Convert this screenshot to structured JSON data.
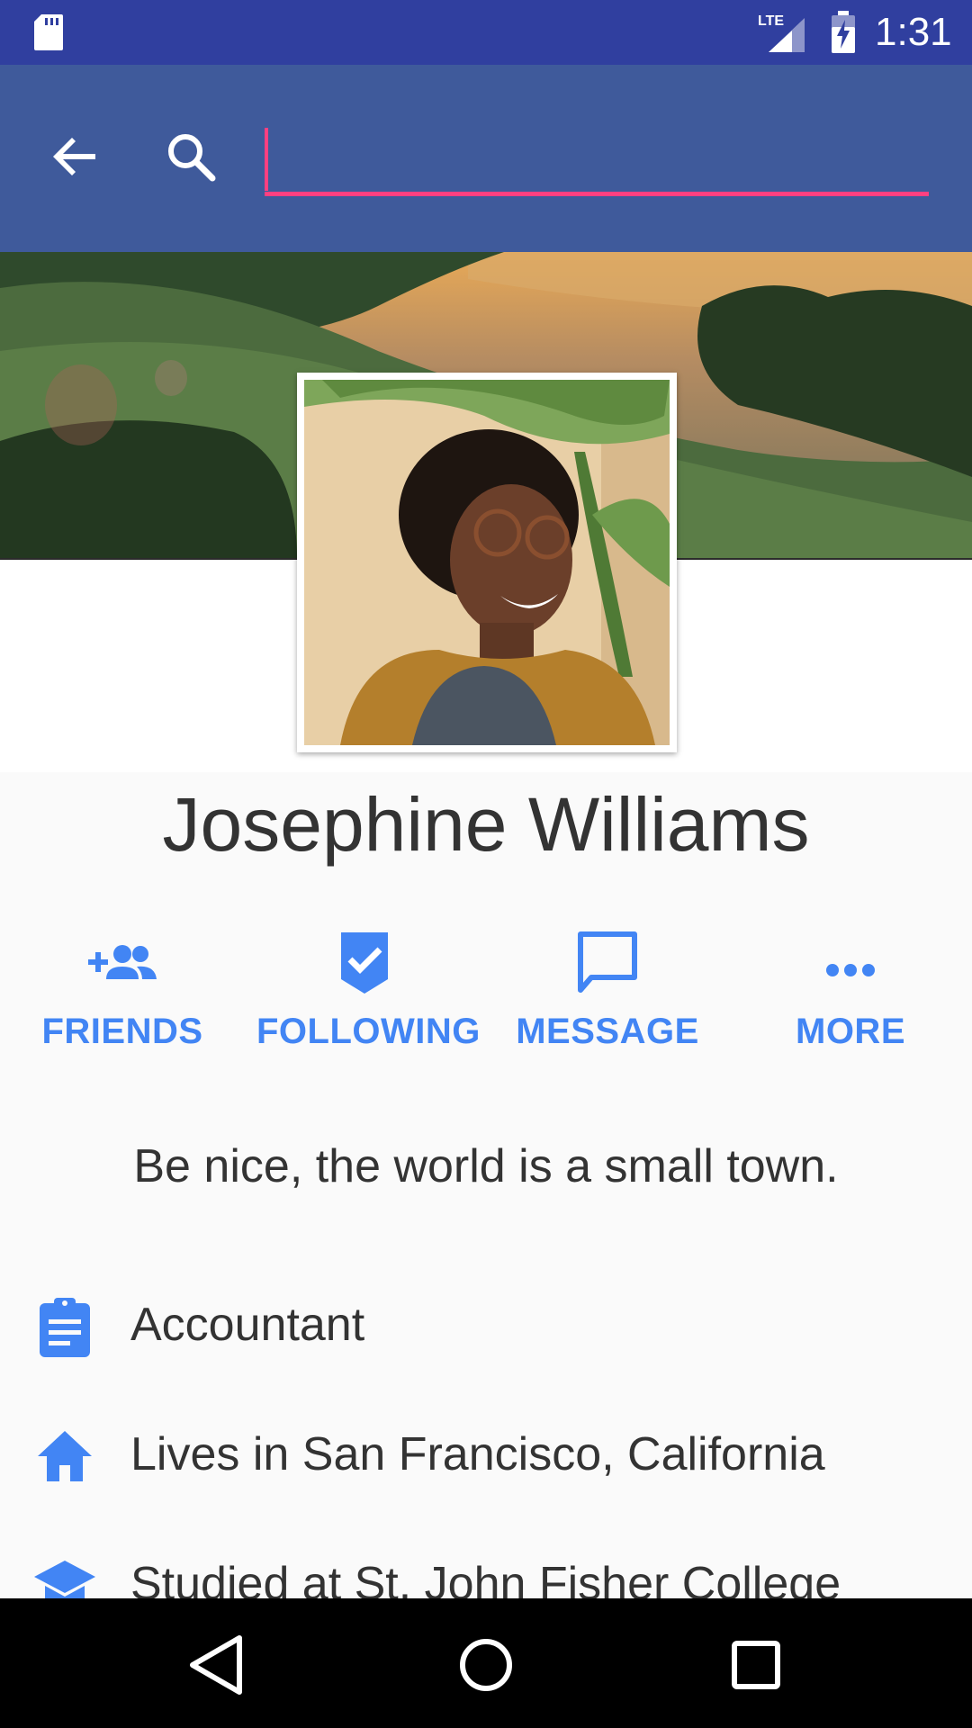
{
  "status_bar": {
    "time": "1:31",
    "network_label": "LTE"
  },
  "search": {
    "value": "",
    "placeholder": ""
  },
  "profile": {
    "name": "Josephine Williams",
    "bio": "Be nice, the world is a small town."
  },
  "actions": [
    {
      "label": "FRIENDS",
      "icon": "add-friends-icon"
    },
    {
      "label": "FOLLOWING",
      "icon": "following-check-icon"
    },
    {
      "label": "MESSAGE",
      "icon": "message-icon"
    },
    {
      "label": "MORE",
      "icon": "more-dots-icon"
    }
  ],
  "info": [
    {
      "text": "Accountant",
      "icon": "assignment-icon"
    },
    {
      "text": "Lives in San Francisco, California",
      "icon": "home-icon"
    },
    {
      "text": "Studied at St. John Fisher College",
      "icon": "school-icon"
    }
  ],
  "colors": {
    "status_bar": "#303f9f",
    "app_bar": "#3f5a9b",
    "accent": "#ff4081",
    "action_blue": "#4285f4"
  }
}
